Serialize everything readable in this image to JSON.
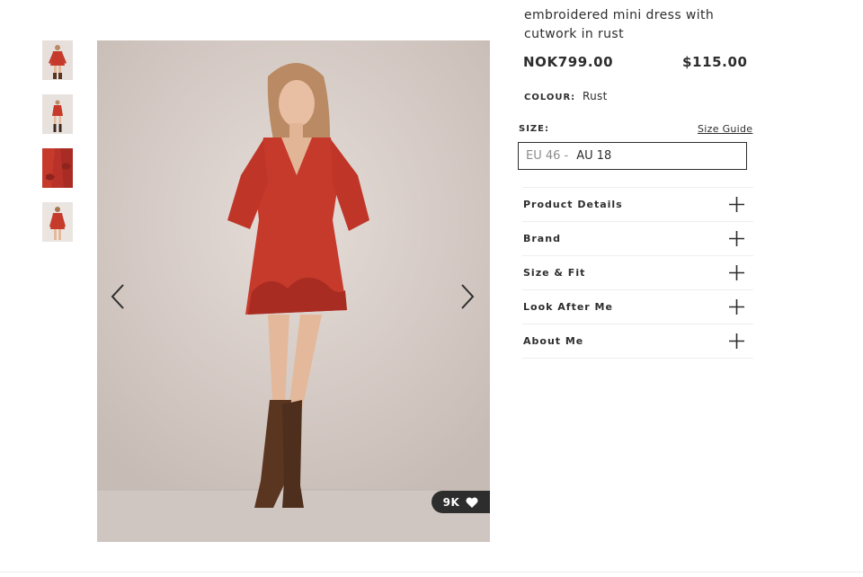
{
  "product": {
    "title": "embroidered mini dress with cutwork in rust",
    "price_now": "NOK799.00",
    "price_alt": "$115.00",
    "colour_label": "COLOUR:",
    "colour_value": "Rust"
  },
  "size": {
    "label": "SIZE:",
    "guide_link": "Size Guide",
    "selected_muted": "EU 46 -",
    "selected_main": "AU 18"
  },
  "accordion": [
    {
      "label": "Product Details"
    },
    {
      "label": "Brand"
    },
    {
      "label": "Size & Fit"
    },
    {
      "label": "Look After Me"
    },
    {
      "label": "About Me"
    }
  ],
  "gallery": {
    "likes": "9K",
    "thumbnail_count": 4,
    "icons": {
      "prev": "chevron-left-icon",
      "next": "chevron-right-icon",
      "like": "heart-icon",
      "expand": "plus-icon"
    }
  },
  "colors": {
    "text": "#2d2d2d",
    "dress": "#c63a2c",
    "boots": "#5a3520",
    "backdrop": "#d6ccc7",
    "divider": "#eeeeee"
  }
}
